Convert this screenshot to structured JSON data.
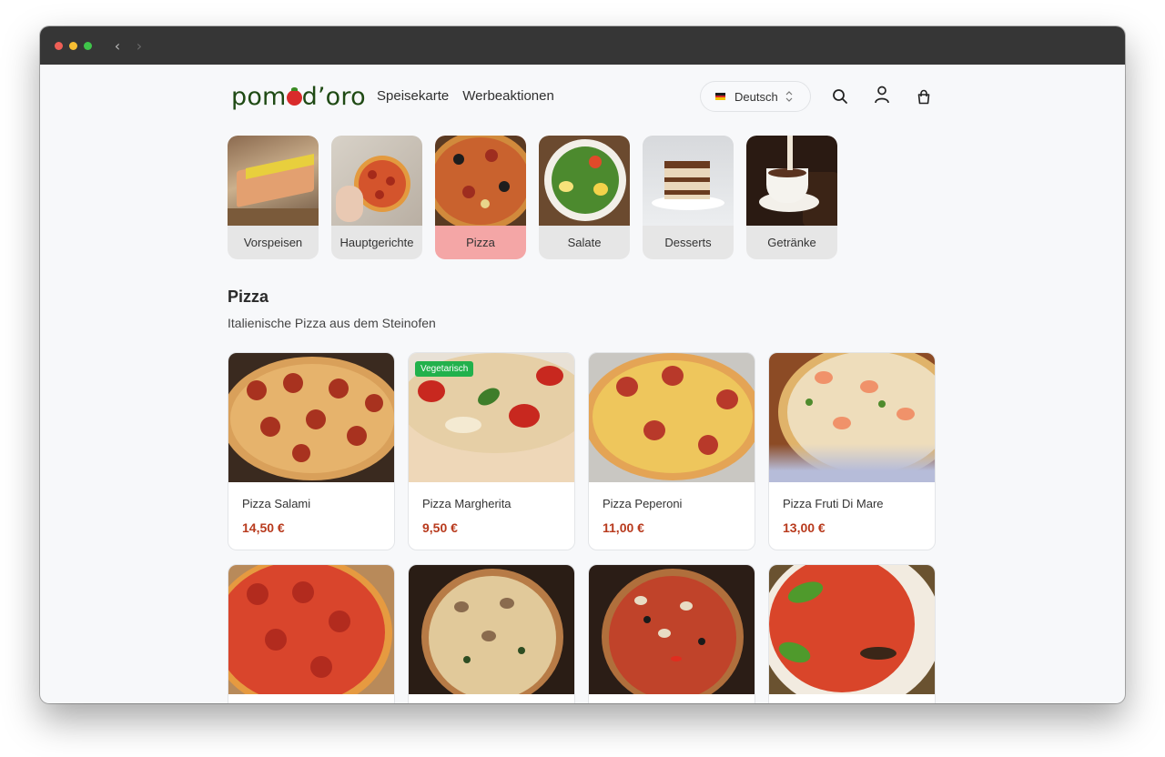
{
  "brand": {
    "logo_pre": "pom",
    "logo_post": "d’oro",
    "logo_color": "#1f4a14"
  },
  "nav": {
    "links": [
      "Speisekarte",
      "Werbeaktionen"
    ]
  },
  "language": {
    "label": "Deutsch"
  },
  "icons": {
    "search": "search-icon",
    "user": "user-icon",
    "cart": "shopping-bag-icon"
  },
  "categories": [
    {
      "label": "Vorspeisen",
      "active": false
    },
    {
      "label": "Hauptgerichte",
      "active": false
    },
    {
      "label": "Pizza",
      "active": true
    },
    {
      "label": "Salate",
      "active": false
    },
    {
      "label": "Desserts",
      "active": false
    },
    {
      "label": "Getränke",
      "active": false
    }
  ],
  "section": {
    "title": "Pizza",
    "subtitle": "Italienische Pizza aus dem Steinofen"
  },
  "products": [
    {
      "name": "Pizza Salami",
      "price": "14,50 €"
    },
    {
      "name": "Pizza Margherita",
      "price": "9,50 €",
      "badge": "Vegetarisch"
    },
    {
      "name": "Pizza Peperoni",
      "price": "11,00 €"
    },
    {
      "name": "Pizza Fruti Di Mare",
      "price": "13,00 €"
    },
    {
      "name": "",
      "price": ""
    },
    {
      "name": "",
      "price": ""
    },
    {
      "name": "",
      "price": ""
    },
    {
      "name": "",
      "price": ""
    }
  ],
  "colors": {
    "accent": "#b83a1d",
    "active_category": "#f4a6a6",
    "badge": "#22b14c"
  }
}
